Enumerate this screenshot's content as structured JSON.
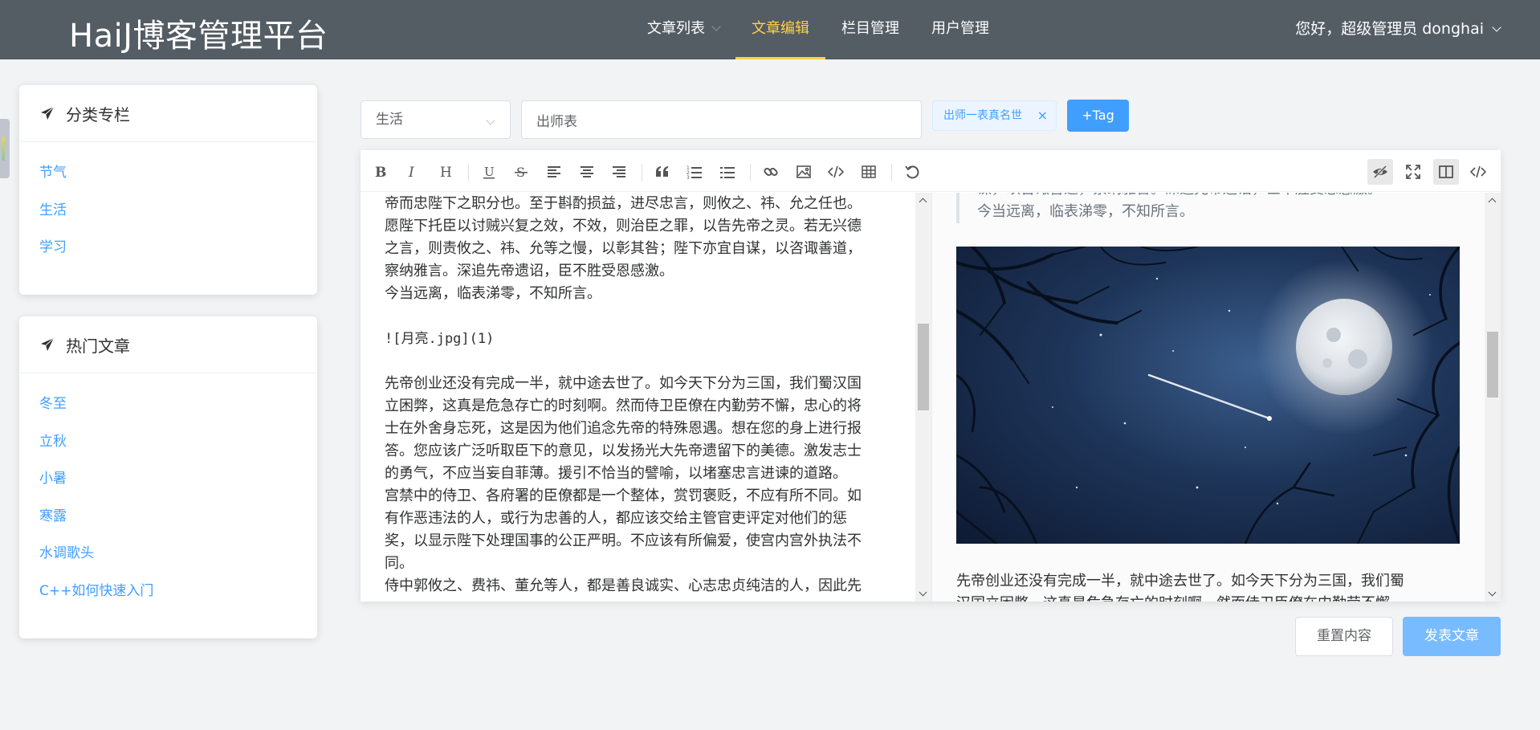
{
  "header": {
    "logo": "HaiJ博客管理平台",
    "nav": [
      {
        "label": "文章列表"
      },
      {
        "label": "文章编辑"
      },
      {
        "label": "栏目管理"
      },
      {
        "label": "用户管理"
      }
    ],
    "user": "您好，超级管理员 donghai"
  },
  "sidebar": {
    "categories": {
      "title": "分类专栏",
      "items": [
        "节气",
        "生活",
        "学习"
      ]
    },
    "hot": {
      "title": "热门文章",
      "items": [
        "冬至",
        "立秋",
        "小暑",
        "寒露",
        "水调歌头",
        "C++如何快速入门"
      ]
    }
  },
  "form": {
    "category": "生活",
    "title": "出师表",
    "tag": "出师一表真名世",
    "add_tag": "+Tag"
  },
  "editor": {
    "toolbar": [
      "bold-icon",
      "italic-icon",
      "heading-icon",
      "underline-icon",
      "strikethrough-icon",
      "align-left-icon",
      "align-center-icon",
      "align-right-icon",
      "quote-icon",
      "ordered-list-icon",
      "unordered-list-icon",
      "link-icon",
      "image-icon",
      "code-icon",
      "table-icon",
      "undo-icon",
      "preview-toggle-icon",
      "fullscreen-icon",
      "split-view-icon",
      "source-code-icon"
    ],
    "source_lines": [
      "帝而忠陛下之职分也。至于斟酌损益，进尽忠言，则攸之、祎、允之任也。",
      "愿陛下托臣以讨贼兴复之效，不效，则治臣之罪，以告先帝之灵。若无兴德",
      "之言，则责攸之、祎、允等之慢，以彰其咎；陛下亦宜自谋，以咨诹善道，",
      "察纳雅言。深追先帝遗诏，臣不胜受恩感激。",
      "今当远离，临表涕零，不知所言。",
      "",
      "![月亮.jpg](1)",
      "",
      "先帝创业还没有完成一半，就中途去世了。如今天下分为三国，我们蜀汉国",
      "立困弊，这真是危急存亡的时刻啊。然而侍卫臣僚在内勤劳不懈，忠心的将",
      "士在外舍身忘死，这是因为他们追念先帝的特殊恩遇。想在您的身上进行报",
      "答。您应该广泛听取臣下的意见，以发扬光大先帝遗留下的美德。激发志士",
      "的勇气，不应当妄自菲薄。援引不恰当的譬喻，以堵塞忠言进谏的道路。",
      "宫禁中的侍卫、各府署的臣僚都是一个整体，赏罚褒贬，不应有所不同。如",
      "有作恶违法的人，或行为忠善的人，都应该交给主管官吏评定对他们的惩",
      "奖，以显示陛下处理国事的公正严明。不应该有所偏爱，使宫内宫外执法不",
      "同。",
      "侍中郭攸之、费祎、董允等人，都是善良诚实、心志忠贞纯洁的人，因此先"
    ],
    "preview_quote": [
      "谋，以咨诹善道，察纳雅言。深追先帝遗诏，臣不胜受恩感激。",
      "今当远离，临表涕零，不知所言。"
    ],
    "preview_paragraph": [
      "先帝创业还没有完成一半，就中途去世了。如今天下分为三国，我们蜀",
      "汉国立困弊，这真是危急存亡的时刻啊。然而侍卫臣僚在内勤劳不懈，"
    ]
  },
  "actions": {
    "reset": "重置内容",
    "publish": "发表文章"
  },
  "colors": {
    "header_bg": "#545c64",
    "active_nav": "#ffd04b",
    "link": "#409eff",
    "primary": "#409eff",
    "publish_disabled": "#79bbff"
  }
}
